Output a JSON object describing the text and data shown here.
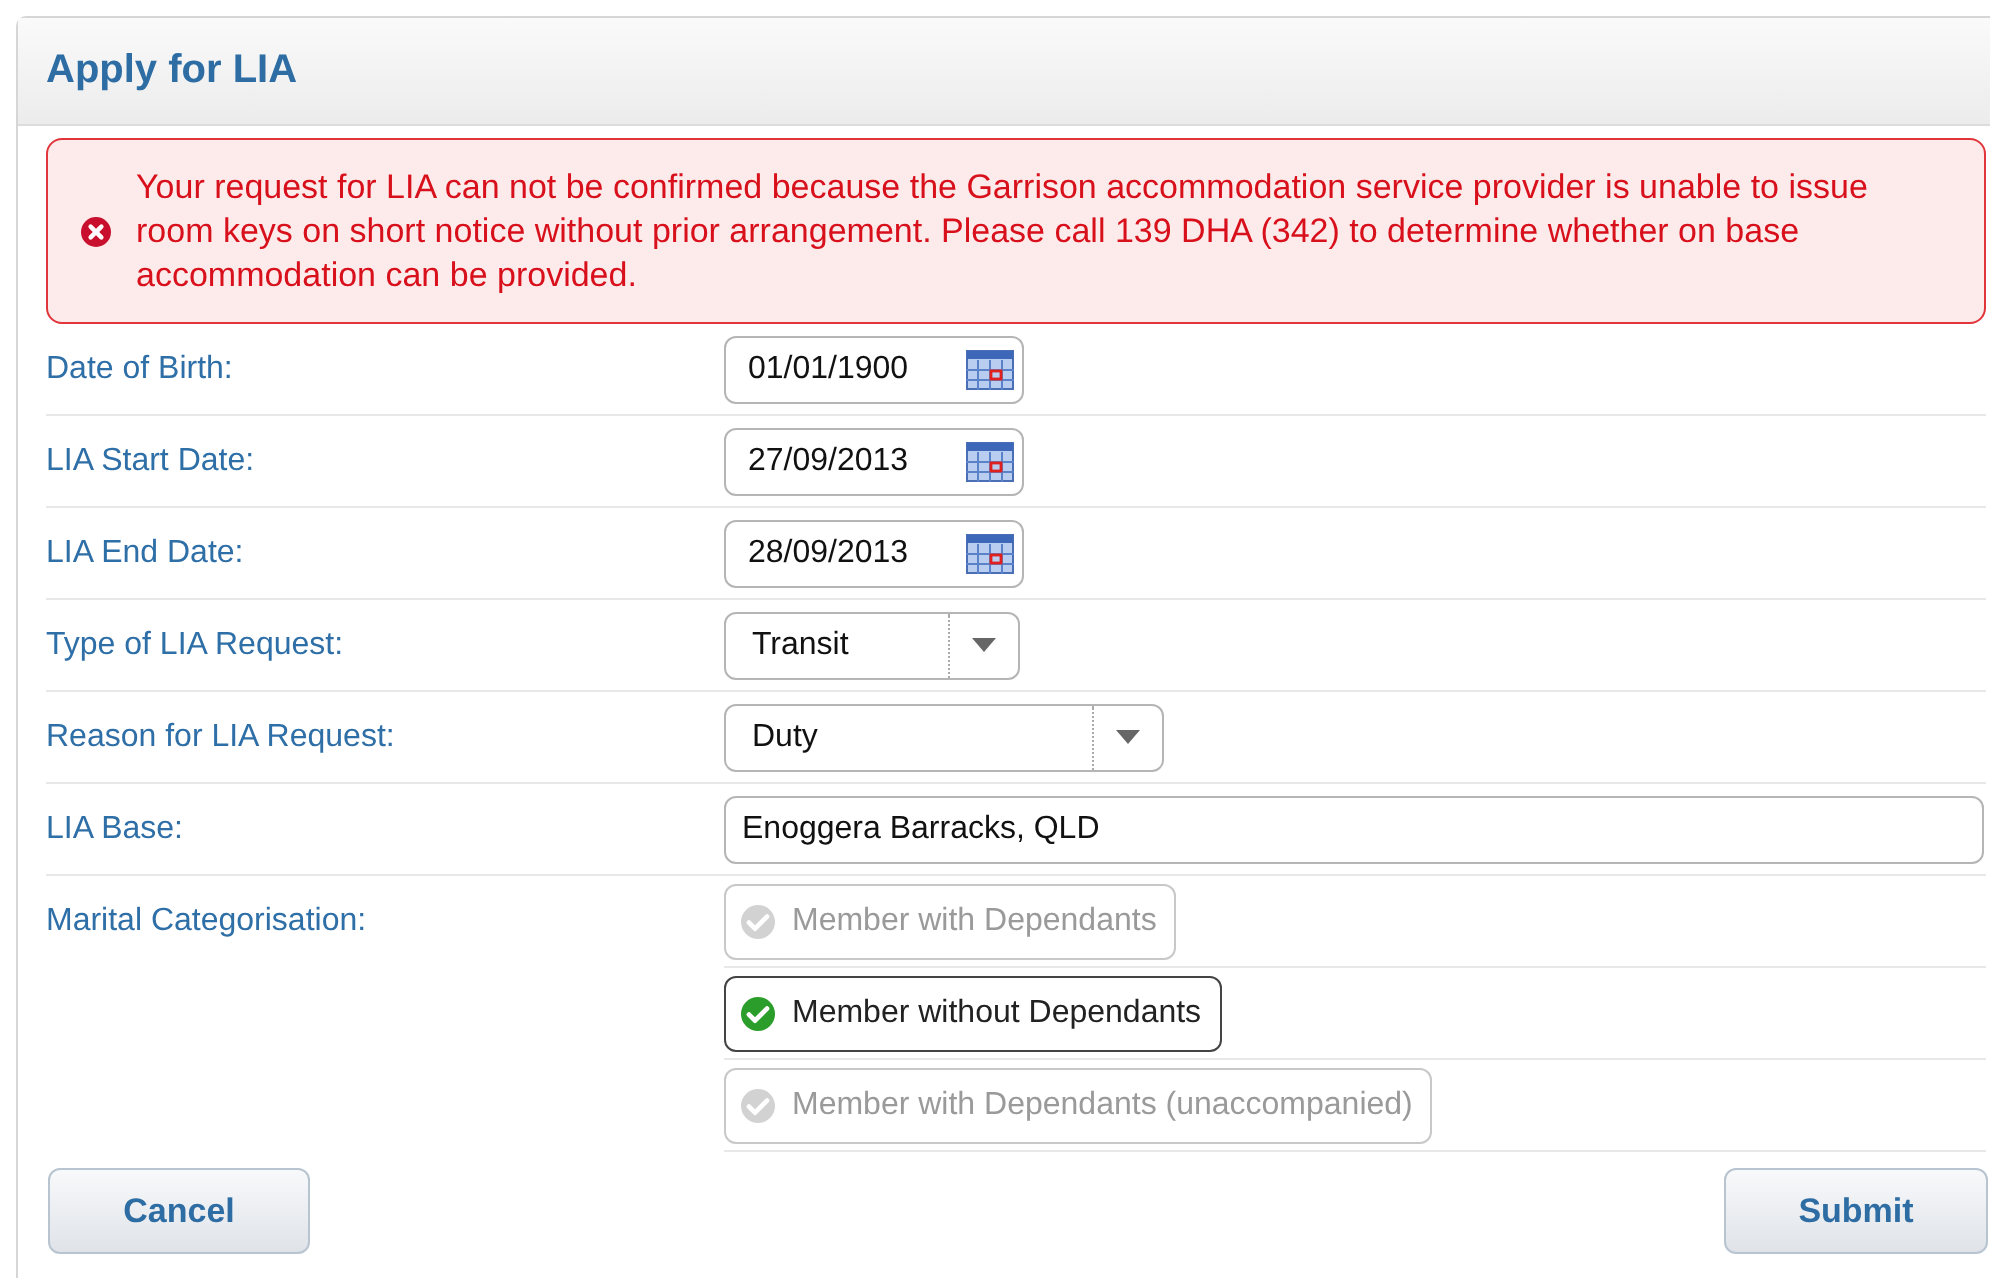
{
  "panel": {
    "title": "Apply for LIA"
  },
  "error": {
    "message": "Your request for LIA can not be confirmed because the Garrison accommodation service provider is unable to issue room keys on short notice without prior arrangement. Please call 139 DHA (342) to determine whether on base accommodation can be provided."
  },
  "fields": [
    {
      "kind": "date",
      "label": "Date of Birth:",
      "value": "01/01/1900"
    },
    {
      "kind": "date",
      "label": "LIA Start Date:",
      "value": "27/09/2013"
    },
    {
      "kind": "date",
      "label": "LIA End Date:",
      "value": "28/09/2013"
    },
    {
      "kind": "select",
      "label": "Type of LIA Request:",
      "value": "Transit"
    },
    {
      "kind": "select",
      "label": "Reason for LIA Request:",
      "value": "Duty"
    },
    {
      "kind": "text",
      "label": "LIA Base:",
      "value": "Enoggera Barracks, QLD"
    },
    {
      "kind": "radio",
      "label": "Marital Categorisation:",
      "options": [
        {
          "label": "Member with Dependants",
          "selected": false
        },
        {
          "label": "Member without Dependants",
          "selected": true
        },
        {
          "label": "Member with Dependants (unaccompanied)",
          "selected": false
        }
      ]
    }
  ],
  "buttons": [
    {
      "kind": "cancel",
      "label": "Cancel"
    },
    {
      "kind": "submit",
      "label": "Submit"
    }
  ]
}
